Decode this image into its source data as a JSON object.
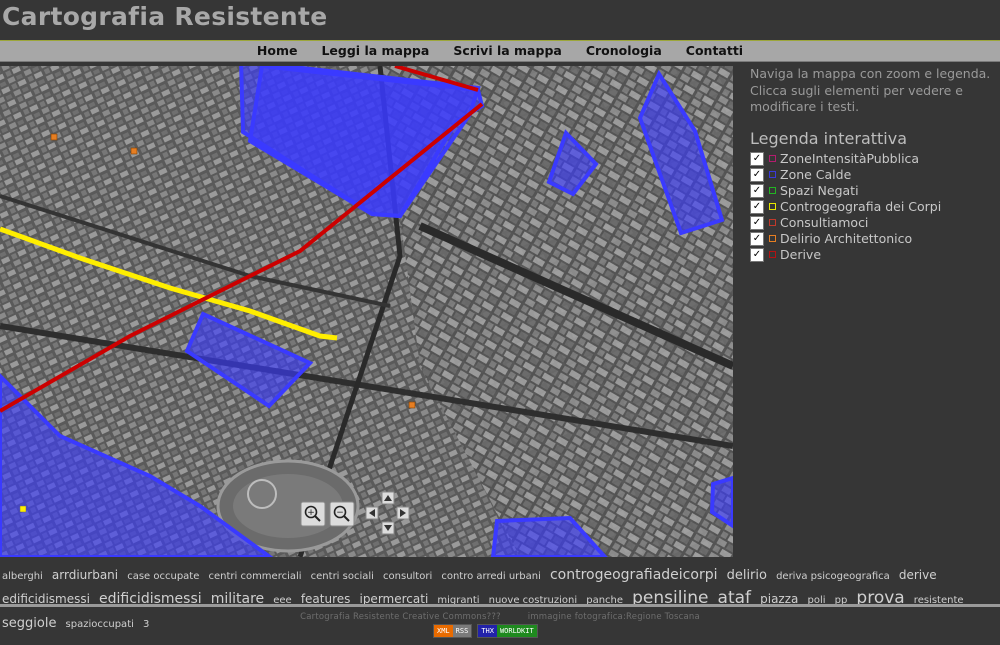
{
  "site": {
    "title": "Cartografia Resistente"
  },
  "nav": {
    "items": [
      {
        "label": "Home"
      },
      {
        "label": "Leggi la mappa"
      },
      {
        "label": "Scrivi la mappa"
      },
      {
        "label": "Cronologia"
      },
      {
        "label": "Contatti"
      }
    ]
  },
  "sidebar": {
    "intro": "Naviga la mappa con zoom e legenda. Clicca sugli elementi per vedere e modificare i testi.",
    "legend_title": "Legenda interattiva",
    "legend": [
      {
        "label": "ZoneIntensitàPubblica",
        "color": "#b31c6e",
        "checked": "✓"
      },
      {
        "label": "Zone Calde",
        "color": "#3a3adb",
        "checked": "✓"
      },
      {
        "label": "Spazi Negati",
        "color": "#22b522",
        "checked": "✓"
      },
      {
        "label": "Controgeografia dei Corpi",
        "color": "#e8e800",
        "checked": "✓"
      },
      {
        "label": "Consultiamoci",
        "color": "#c0392b",
        "checked": "✓"
      },
      {
        "label": "Delirio Architettonico",
        "color": "#e67e22",
        "checked": "✓"
      },
      {
        "label": "Derive",
        "color": "#b31212",
        "checked": "✓"
      }
    ]
  },
  "map": {
    "zoom_in": "+",
    "zoom_out": "−",
    "colors": {
      "zone": "#3a3aff",
      "derive": "#cc0000",
      "corpi": "#ffee00",
      "marker": "#e67e22"
    }
  },
  "tags": [
    {
      "t": "alberghi",
      "s": 10
    },
    {
      "t": "arrdiurbani",
      "s": 12
    },
    {
      "t": "case occupate",
      "s": 10
    },
    {
      "t": "centri commerciali",
      "s": 10
    },
    {
      "t": "centri sociali",
      "s": 10
    },
    {
      "t": "consultori",
      "s": 10
    },
    {
      "t": "contro arredi urbani",
      "s": 10
    },
    {
      "t": "controgeografiadeicorpi",
      "s": 14
    },
    {
      "t": "delirio",
      "s": 13
    },
    {
      "t": "deriva psicogeografica",
      "s": 10
    },
    {
      "t": "derive",
      "s": 12
    },
    {
      "t": "edificidismessi",
      "s": 12
    },
    {
      "t": "edificidismessi",
      "s": 14
    },
    {
      "t": "militare",
      "s": 14
    },
    {
      "t": "eee",
      "s": 10
    },
    {
      "t": "features",
      "s": 12
    },
    {
      "t": "ipermercati",
      "s": 12
    },
    {
      "t": "migranti",
      "s": 10
    },
    {
      "t": "nuove costruzioni",
      "s": 10
    },
    {
      "t": "panche",
      "s": 10
    },
    {
      "t": "pensiline",
      "s": 17
    },
    {
      "t": "ataf",
      "s": 17
    },
    {
      "t": "piazza",
      "s": 12
    },
    {
      "t": "poli",
      "s": 10
    },
    {
      "t": "pp",
      "s": 10
    },
    {
      "t": "prova",
      "s": 17
    },
    {
      "t": "resistente",
      "s": 10
    },
    {
      "t": "seggiole",
      "s": 13
    },
    {
      "t": "spazioccupati",
      "s": 10
    },
    {
      "t": "3",
      "s": 10
    }
  ],
  "footer": {
    "left": "Cartografia Resistente Creative Commons???",
    "right": "immagine fotografica:Regione Toscana",
    "badge_xml_left": "XML",
    "badge_xml_right": "RSS",
    "badge_wk_left": "THX",
    "badge_wk_right": "WORLDKIT"
  }
}
